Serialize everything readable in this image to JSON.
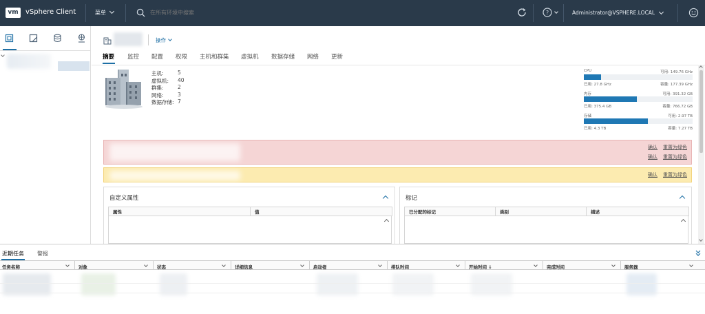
{
  "header": {
    "logo": "vm",
    "app_title": "vSphere Client",
    "menu_label": "菜单",
    "search_placeholder": "在所有环境中搜索",
    "user": "Administrator@VSPHERE.LOCAL"
  },
  "object": {
    "actions_label": "操作"
  },
  "tabs": [
    "摘要",
    "监控",
    "配置",
    "权限",
    "主机和群集",
    "虚拟机",
    "数据存储",
    "网络",
    "更新"
  ],
  "stats": [
    {
      "label": "主机:",
      "value": "5"
    },
    {
      "label": "虚拟机:",
      "value": "40"
    },
    {
      "label": "群集:",
      "value": "2"
    },
    {
      "label": "网络:",
      "value": "3"
    },
    {
      "label": "数据存储:",
      "value": "7"
    }
  ],
  "resources": [
    {
      "name": "CPU",
      "free": "可用: 149.76 GHz",
      "used": "已用: 27.8 GHz",
      "capacity": "容量: 177.39 GHz",
      "used_fraction": 0.157
    },
    {
      "name": "内存",
      "free": "可用: 391.32 GB",
      "used": "已用: 375.4 GB",
      "capacity": "容量: 766.72 GB",
      "used_fraction": 0.49
    },
    {
      "name": "存储",
      "free": "可用: 2.97 TB",
      "used": "已用: 4.3 TB",
      "capacity": "容量: 7.27 TB",
      "used_fraction": 0.59
    }
  ],
  "alerts": {
    "ack": "确认",
    "reset": "重置为绿色"
  },
  "custom_attrs": {
    "title": "自定义属性",
    "col_attr": "属性",
    "col_value": "值"
  },
  "tags_panel": {
    "title": "标记",
    "col_tag": "已分配的标记",
    "col_category": "类别",
    "col_desc": "描述"
  },
  "bottom": {
    "tab_recent": "近期任务",
    "tab_alarms": "警报",
    "columns": [
      "任务名称",
      "对象",
      "状态",
      "详细信息",
      "启动者",
      "排队时间",
      "开始时间 ↓",
      "完成时间",
      "服务器"
    ]
  },
  "colors": {
    "topbar": "#2a3a4a",
    "accent": "#1d6fa5",
    "bar_fill": "#1f78b4",
    "alert_red": "#f5d5d5",
    "alert_yellow": "#fcebb0"
  }
}
